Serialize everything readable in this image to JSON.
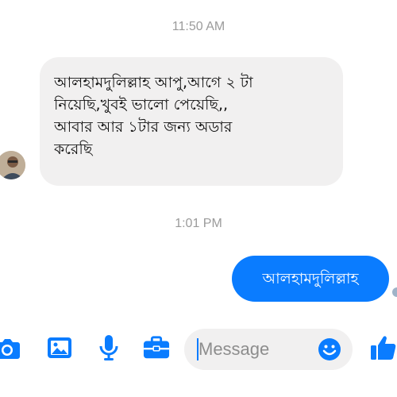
{
  "conversation": {
    "timestamps": [
      "11:50 AM",
      "1:01 PM"
    ],
    "incoming_message": {
      "lines": [
        "আলহামদুলিল্লাহ  আপু,আগে ২ টা",
        "নিয়েছি,খুবই ভালো  পেয়েছি,,",
        "আবার আর ১টার জন্য অডার",
        "করেছি"
      ]
    },
    "outgoing_message": {
      "text": "আলহামদুলিল্লাহ"
    }
  },
  "composer": {
    "placeholder": "Message"
  },
  "toolbar": {
    "icons": [
      "camera-icon",
      "photo-icon",
      "microphone-icon",
      "briefcase-icon",
      "emoji-icon",
      "like-icon"
    ]
  },
  "colors": {
    "accent": "#0a7cff",
    "incoming_bubble": "#f1f0f0",
    "timestamp": "#9b9b9b"
  }
}
